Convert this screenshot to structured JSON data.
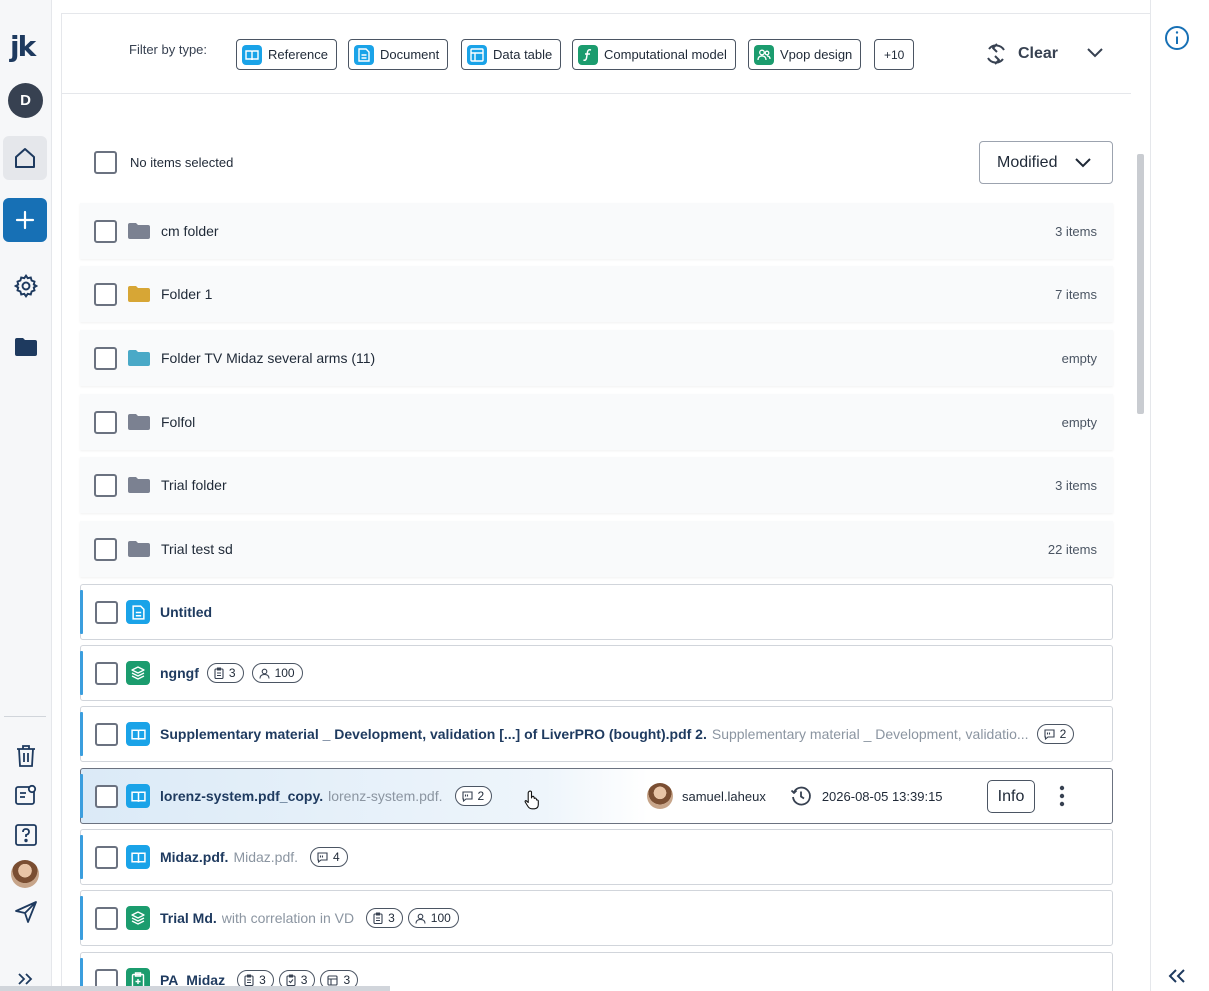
{
  "sidebar": {
    "logo": "jk",
    "avatar_initial": "D"
  },
  "filter": {
    "label": "Filter by type:",
    "chips": [
      {
        "label": "Reference",
        "icon": "reference-icon",
        "color": "#1aa3e8"
      },
      {
        "label": "Document",
        "icon": "document-icon",
        "color": "#1aa3e8"
      },
      {
        "label": "Data table",
        "icon": "data-table-icon",
        "color": "#1aa3e8"
      },
      {
        "label": "Computational model",
        "icon": "function-icon",
        "color": "#1b9c6e"
      },
      {
        "label": "Vpop design",
        "icon": "people-icon",
        "color": "#1b9c6e"
      }
    ],
    "more": "+10",
    "clear": "Clear"
  },
  "list_header": {
    "selection_label": "No items selected",
    "sort_label": "Modified"
  },
  "folders": [
    {
      "name": "cm folder",
      "count": "3 items",
      "color": "#7b8191"
    },
    {
      "name": "Folder 1",
      "count": "7 items",
      "color": "#d7a635"
    },
    {
      "name": "Folder TV Midaz several arms (11)",
      "count": "empty",
      "color": "#4aa9c7"
    },
    {
      "name": "Folfol",
      "count": "empty",
      "color": "#7b8191"
    },
    {
      "name": "Trial folder",
      "count": "3 items",
      "color": "#7b8191"
    },
    {
      "name": "Trial test sd",
      "count": "22 items",
      "color": "#7b8191"
    }
  ],
  "items": [
    {
      "title": "Untitled"
    },
    {
      "title": "ngngf",
      "pills": [
        "3",
        "100"
      ]
    },
    {
      "title": "Supplementary material _ Development, validation [...] of LiverPRO (bought).pdf 2.",
      "subtitle": "Supplementary material _ Development, validatio...",
      "pills": [
        "2"
      ]
    },
    {
      "title": "lorenz-system.pdf_copy.",
      "subtitle": "lorenz-system.pdf.",
      "pills": [
        "2"
      ],
      "owner": "samuel.laheux",
      "modified": "2026-08-05 13:39:15",
      "info_label": "Info"
    },
    {
      "title": "Midaz.pdf.",
      "subtitle": "Midaz.pdf.",
      "pills": [
        "4"
      ]
    },
    {
      "title": "Trial Md.",
      "subtitle": "with correlation in VD",
      "pills": [
        "3",
        "100"
      ]
    },
    {
      "title": "PA_Midaz",
      "pills": [
        "3",
        "3",
        "3"
      ]
    }
  ]
}
